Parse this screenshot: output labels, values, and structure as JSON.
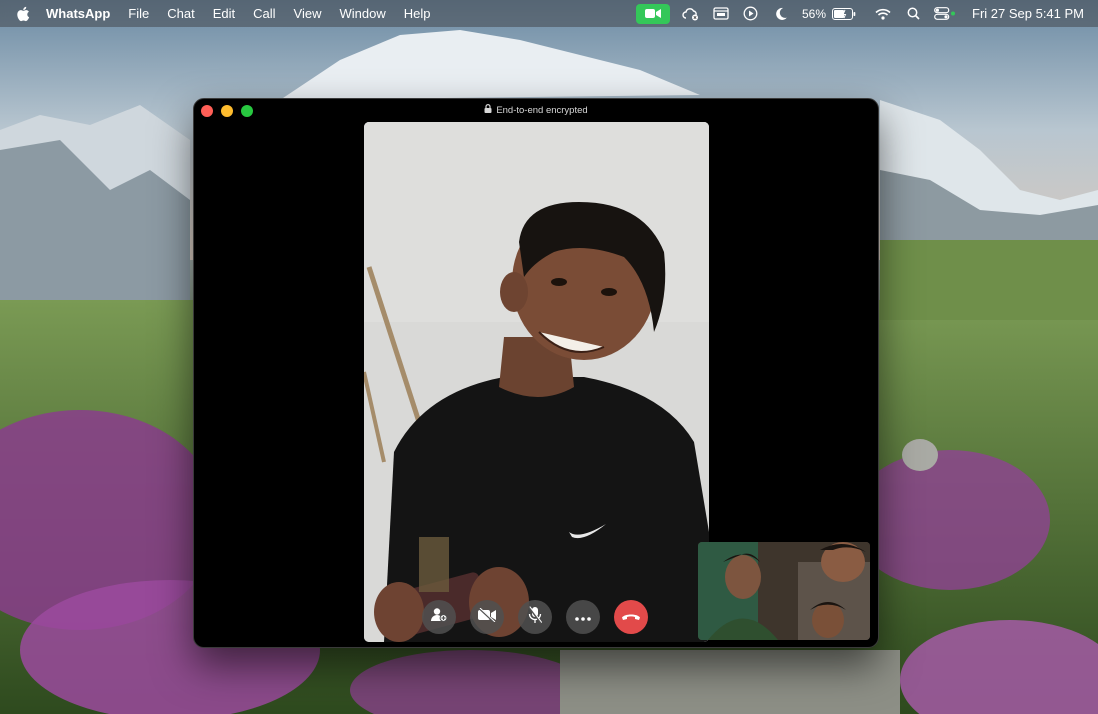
{
  "menubar": {
    "app_name": "WhatsApp",
    "menus": [
      "File",
      "Chat",
      "Edit",
      "Call",
      "View",
      "Window",
      "Help"
    ],
    "battery_percent": "56%",
    "datetime": "Fri 27 Sep  5:41 PM"
  },
  "call_window": {
    "encryption_label": "End-to-end encrypted"
  },
  "icons": {
    "apple": "apple-icon",
    "camera_status": "video-camera-icon",
    "add_participant": "add-person-icon",
    "camera_off": "camera-off-icon",
    "mute": "mic-off-icon",
    "more": "more-icon",
    "end_call": "end-call-icon"
  },
  "colors": {
    "end_call": "#e24a4a",
    "camera_status": "#34c759",
    "window_bg": "#000000"
  }
}
